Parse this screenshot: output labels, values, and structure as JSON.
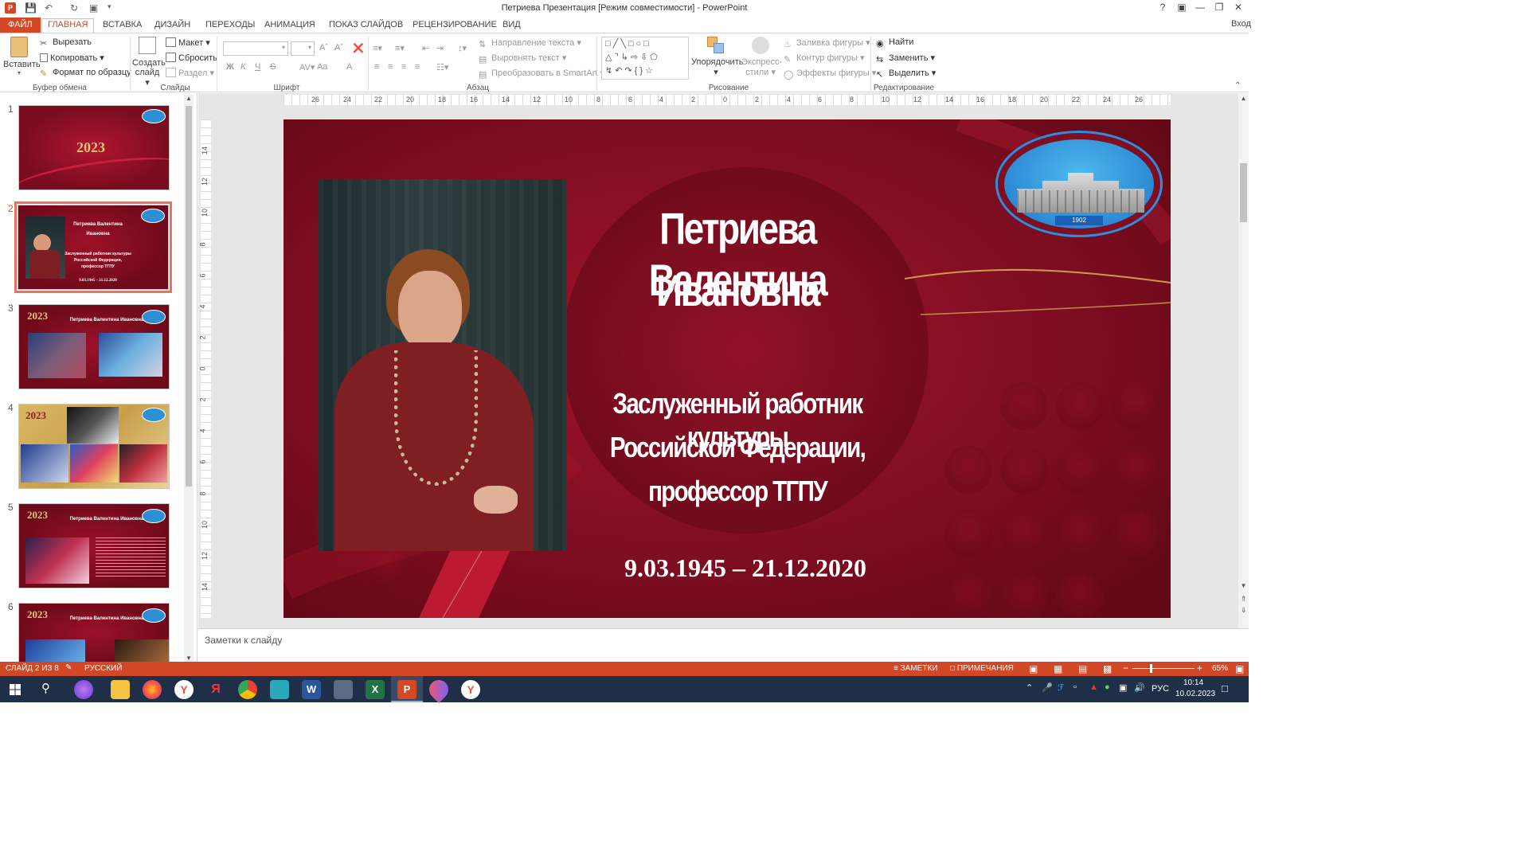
{
  "titlebar": {
    "title": "Петриева Презентация [Режим совместимости] - PowerPoint",
    "help": "?",
    "login": "Вход"
  },
  "tabs": [
    "ФАЙЛ",
    "ГЛАВНАЯ",
    "ВСТАВКА",
    "ДИЗАЙН",
    "ПЕРЕХОДЫ",
    "АНИМАЦИЯ",
    "ПОКАЗ СЛАЙДОВ",
    "РЕЦЕНЗИРОВАНИЕ",
    "ВИД"
  ],
  "ribbon": {
    "clipboard": {
      "paste": "Вставить",
      "cut": "Вырезать",
      "copy": "Копировать",
      "format": "Формат по образцу",
      "label": "Буфер обмена"
    },
    "slides": {
      "new": "Создать",
      "new2": "слайд",
      "layout": "Макет",
      "reset": "Сбросить",
      "section": "Раздел",
      "label": "Слайды"
    },
    "font": {
      "label": "Шрифт",
      "bold": "Ж",
      "italic": "К",
      "underline": "Ч",
      "strike": "S",
      "case": "Aa",
      "color": "A"
    },
    "paragraph": {
      "dir": "Направление текста",
      "align": "Выровнять текст",
      "smartart": "Преобразовать в SmartArt",
      "label": "Абзац"
    },
    "drawing": {
      "arrange": "Упорядочить",
      "styles": "Экспресс-",
      "styles2": "стили",
      "fill": "Заливка фигуры",
      "outline": "Контур фигуры",
      "effects": "Эффекты фигуры",
      "label": "Рисование"
    },
    "editing": {
      "find": "Найти",
      "replace": "Заменить",
      "select": "Выделить",
      "label": "Редактирование"
    }
  },
  "ruler_h": [
    "26",
    "24",
    "22",
    "20",
    "18",
    "16",
    "14",
    "12",
    "10",
    "8",
    "6",
    "4",
    "2",
    "0",
    "2",
    "4",
    "6",
    "8",
    "10",
    "12",
    "14",
    "16",
    "18",
    "20",
    "22",
    "24",
    "26"
  ],
  "ruler_v": [
    "14",
    "12",
    "10",
    "8",
    "6",
    "4",
    "2",
    "0",
    "2",
    "4",
    "6",
    "8",
    "10",
    "12",
    "14"
  ],
  "thumbs": [
    {
      "num": "1",
      "year": "2023"
    },
    {
      "num": "2",
      "t1": "Петриева Валентина",
      "t2": "Ивановна",
      "s1": "Заслуженный работник культуры",
      "s2": "Российской Федерации,",
      "s3": "профессор ТГПУ",
      "d": "9.03.1945 – 21.12.2020"
    },
    {
      "num": "3",
      "year": "2023",
      "title": "Петриева Валентина Ивановна"
    },
    {
      "num": "4",
      "year": "2023"
    },
    {
      "num": "5",
      "year": "2023",
      "title": "Петриева Валентина Ивановна"
    },
    {
      "num": "6",
      "year": "2023",
      "title": "Петриева Валентина Ивановна"
    }
  ],
  "slide": {
    "name1": "Петриева Валентина",
    "name2": "Ивановна",
    "sub1": "Заслуженный работник культуры",
    "sub2": "Российской Федерации,",
    "sub3": "профессор ТГПУ",
    "dates": "9.03.1945 – 21.12.2020",
    "logo_year": "1902"
  },
  "notes": {
    "placeholder": "Заметки к слайду"
  },
  "status": {
    "slide": "СЛАЙД 2 ИЗ 8",
    "lang": "РУССКИЙ",
    "notes": "ЗАМЕТКИ",
    "comments": "ПРИМЕЧАНИЯ",
    "zoom": "65%"
  },
  "taskbar": {
    "lang": "РУС",
    "time": "10:14",
    "date": "10.02.2023"
  },
  "colors": {
    "accent": "#d24726",
    "slide_bg": "#7e0f22",
    "taskbar": "#1f2f47"
  }
}
